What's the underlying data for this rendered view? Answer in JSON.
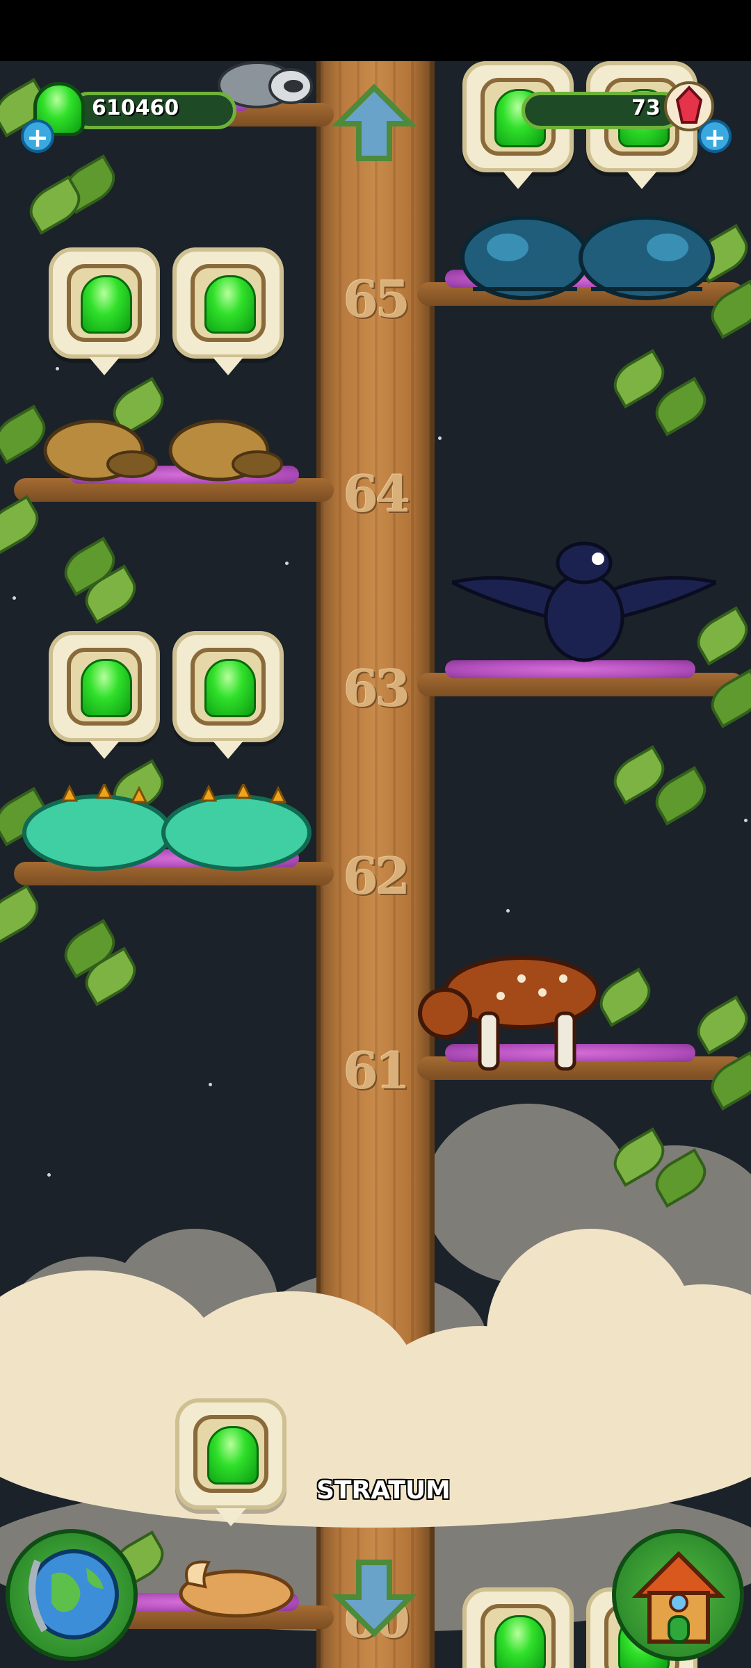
{
  "status_bar": {},
  "hud": {
    "food_count": "610460",
    "gem_count": "73",
    "food_icon": "green-jelly-icon",
    "gem_icon": "red-crystal-icon",
    "add_icon": "plus-icon"
  },
  "tree": {
    "levels": [
      {
        "number": "65",
        "side": "right",
        "animal": "blue armored beetle"
      },
      {
        "number": "64",
        "side": "left",
        "animal": "brown sleeping cub"
      },
      {
        "number": "63",
        "side": "right",
        "animal": "dark crow"
      },
      {
        "number": "62",
        "side": "left",
        "animal": "teal spiky lizard"
      },
      {
        "number": "61",
        "side": "right",
        "animal": "spotted brown horse"
      },
      {
        "number": "60",
        "side": "left",
        "animal": "sleeping fox"
      }
    ]
  },
  "zone": {
    "label": "STRATUM"
  },
  "buttons": {
    "up_icon": "up-arrow-icon",
    "down_icon": "down-arrow-icon",
    "globe_icon": "globe-icon",
    "house_icon": "house-icon"
  },
  "colors": {
    "sky": "#1b2229",
    "trunk": "#c98b4a",
    "jelly": "#30e02a",
    "nest": "#c45cc9",
    "hud_bar": "#1f4a26"
  }
}
